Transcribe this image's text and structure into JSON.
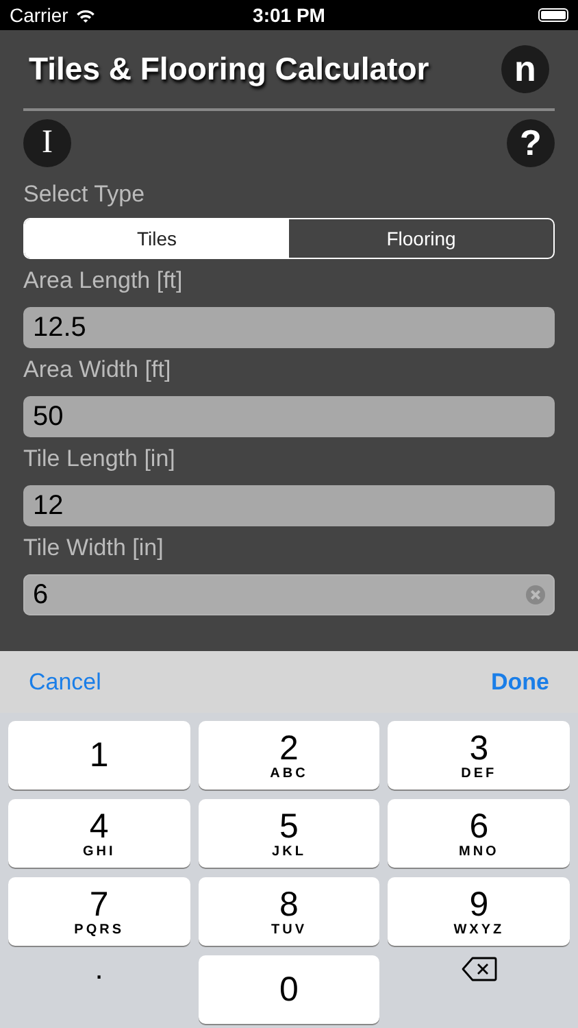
{
  "status_bar": {
    "carrier": "Carrier",
    "time": "3:01 PM"
  },
  "header": {
    "title": "Tiles & Flooring Calculator",
    "logo": "n"
  },
  "toolbar": {
    "info": "I",
    "help": "?"
  },
  "type_selector": {
    "label": "Select Type",
    "options": [
      {
        "label": "Tiles",
        "selected": true
      },
      {
        "label": "Flooring",
        "selected": false
      }
    ]
  },
  "fields": [
    {
      "label": "Area Length [ft]",
      "value": "12.5",
      "focused": false
    },
    {
      "label": "Area Width [ft]",
      "value": "50",
      "focused": false
    },
    {
      "label": "Tile Length [in]",
      "value": "12",
      "focused": false
    },
    {
      "label": "Tile Width [in]",
      "value": "6",
      "focused": true
    }
  ],
  "keyboard_toolbar": {
    "cancel": "Cancel",
    "done": "Done"
  },
  "keys": [
    {
      "kind": "digit",
      "label": "1"
    },
    {
      "kind": "digit",
      "label": "2",
      "letters": "ABC"
    },
    {
      "kind": "digit",
      "label": "3",
      "letters": "DEF"
    },
    {
      "kind": "digit",
      "label": "4",
      "letters": "GHI"
    },
    {
      "kind": "digit",
      "label": "5",
      "letters": "JKL"
    },
    {
      "kind": "digit",
      "label": "6",
      "letters": "MNO"
    },
    {
      "kind": "digit",
      "label": "7",
      "letters": "PQRS"
    },
    {
      "kind": "digit",
      "label": "8",
      "letters": "TUV"
    },
    {
      "kind": "digit",
      "label": "9",
      "letters": "WXYZ"
    },
    {
      "kind": "plain",
      "label": "."
    },
    {
      "kind": "digit",
      "label": "0"
    },
    {
      "kind": "delete"
    }
  ]
}
